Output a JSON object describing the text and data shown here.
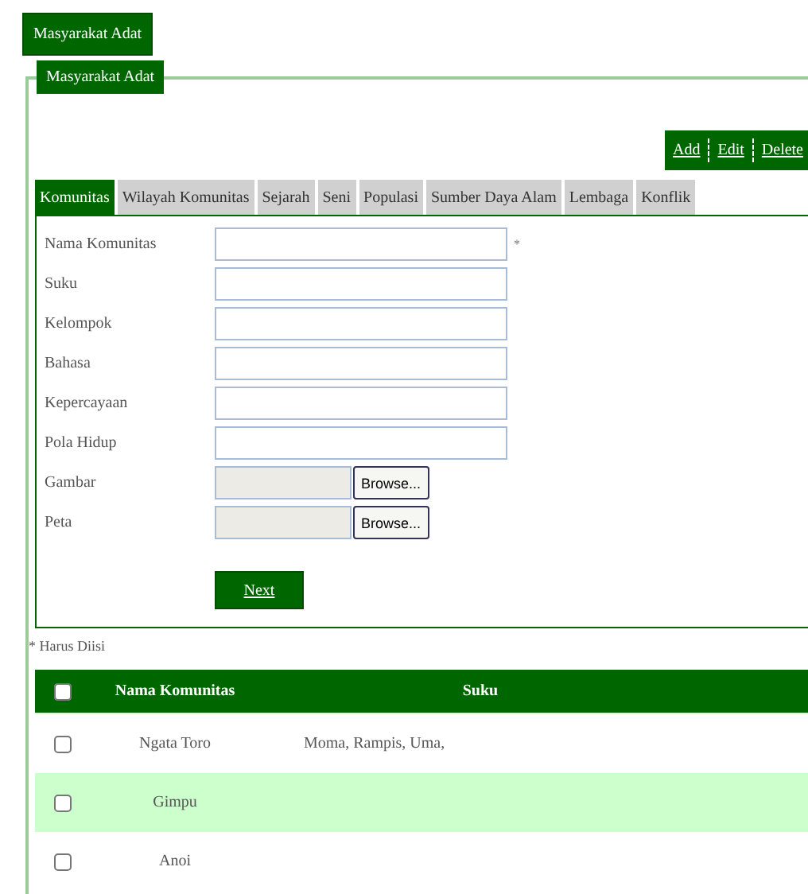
{
  "header_button": "Masyarakat Adat",
  "panel": {
    "legend": "Masyarakat Adat",
    "actions": [
      "Add",
      "Edit",
      "Delete"
    ],
    "tabs": [
      {
        "label": "Komunitas",
        "selected": true
      },
      {
        "label": "Wilayah Komunitas",
        "selected": false
      },
      {
        "label": "Sejarah",
        "selected": false
      },
      {
        "label": "Seni",
        "selected": false
      },
      {
        "label": "Populasi",
        "selected": false
      },
      {
        "label": "Sumber Daya Alam",
        "selected": false
      },
      {
        "label": "Lembaga",
        "selected": false
      },
      {
        "label": "Konflik",
        "selected": false
      }
    ],
    "form": {
      "fields": [
        {
          "label": "Nama Komunitas",
          "kind": "text",
          "required_mark": "*"
        },
        {
          "label": "Suku",
          "kind": "text"
        },
        {
          "label": "Kelompok",
          "kind": "text"
        },
        {
          "label": "Bahasa",
          "kind": "text"
        },
        {
          "label": "Kepercayaan",
          "kind": "text"
        },
        {
          "label": "Pola Hidup",
          "kind": "text"
        },
        {
          "label": "Gambar",
          "kind": "file",
          "button": "Browse..."
        },
        {
          "label": "Peta",
          "kind": "file",
          "button": "Browse..."
        }
      ],
      "submit": "Next"
    },
    "note": "* Harus Diisi",
    "table": {
      "header_checked": false,
      "columns": [
        "Nama Komunitas",
        "Suku"
      ],
      "rows": [
        {
          "checked": false,
          "highlighted": false,
          "cells": [
            "Ngata Toro",
            "Moma, Rampis, Uma,"
          ]
        },
        {
          "checked": false,
          "highlighted": true,
          "cells": [
            "Gimpu",
            ""
          ]
        },
        {
          "checked": false,
          "highlighted": false,
          "cells": [
            "Anoi",
            ""
          ]
        }
      ]
    }
  }
}
